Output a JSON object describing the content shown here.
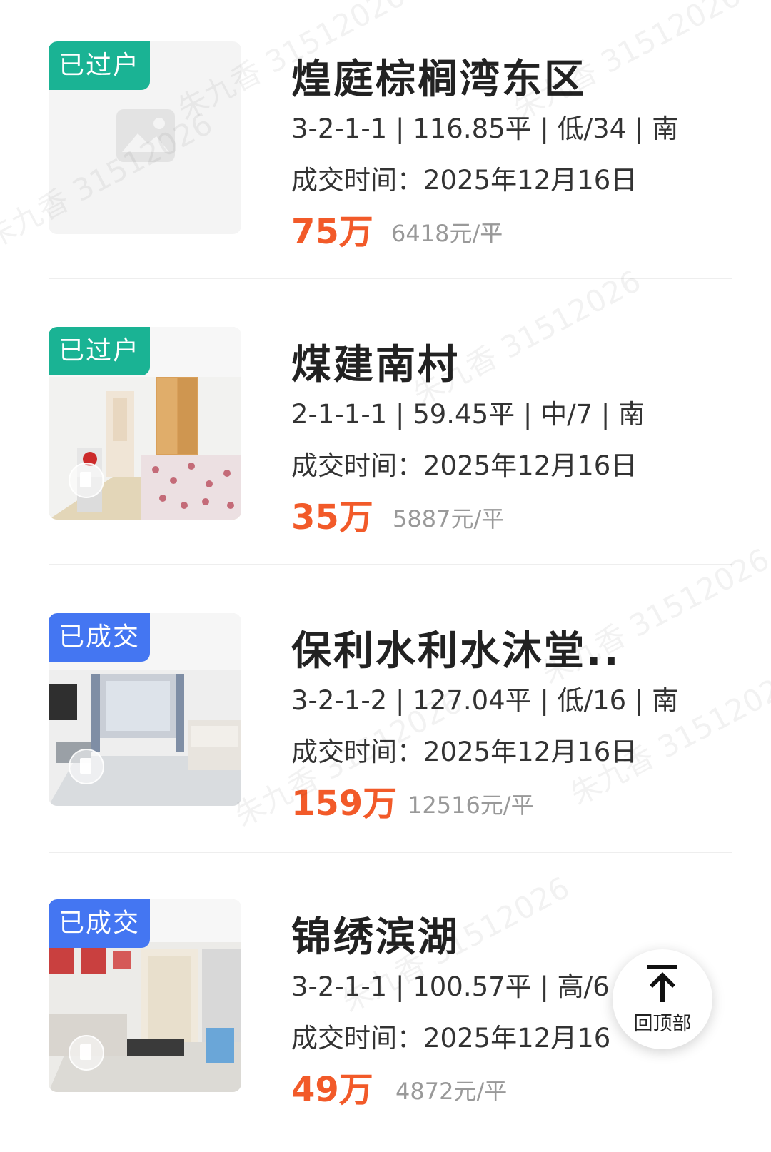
{
  "listings": [
    {
      "badge": "已过户",
      "title": "煌庭棕榈湾东区",
      "meta": "3-2-1-1 | 116.85平 | 低/34 | 南",
      "deal_time": "成交时间：2025年12月16日",
      "price": "75万",
      "unit_price": "6418元/平",
      "image": "placeholder"
    },
    {
      "badge": "已过户",
      "title": "煤建南村",
      "meta": "2-1-1-1 | 59.45平 | 中/7 | 南",
      "deal_time": "成交时间：2025年12月16日",
      "price": "35万",
      "unit_price": "5887元/平",
      "image": "bedroom-photo"
    },
    {
      "badge": "已成交",
      "title": "保利水利水沐堂..",
      "meta": "3-2-1-2 | 127.04平 | 低/16 | 南",
      "deal_time": "成交时间：2025年12月16日",
      "price": "159万",
      "unit_price": "12516元/平",
      "image": "living-room-photo"
    },
    {
      "badge": "已成交",
      "title": "锦绣滨湖",
      "meta": "3-2-1-1 | 100.57平 | 高/6 |",
      "deal_time": "成交时间：2025年12月16",
      "price": "49万",
      "unit_price": "4872元/平",
      "image": "living-room-photo"
    }
  ],
  "back_to_top": {
    "label": "回顶部",
    "icon": "arrow-up-icon"
  },
  "watermark": "朱九香 31512026",
  "colors": {
    "badge_transferred": "#1ab394",
    "badge_sold": "#4476f2",
    "price": "#f25a29",
    "unit_price": "#999999",
    "title": "#222222"
  }
}
